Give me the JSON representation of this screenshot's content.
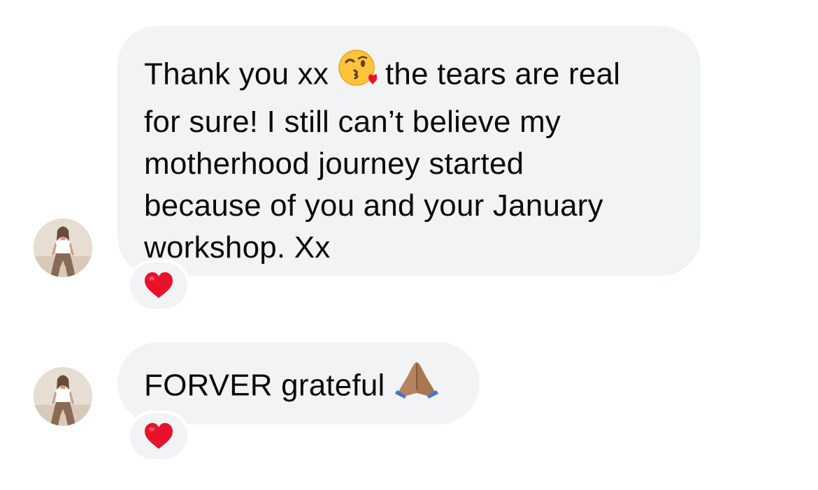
{
  "messages": [
    {
      "lines": [
        {
          "before": "Thank you xx",
          "after": "the tears are real"
        },
        {
          "text": "for sure! I still can’t believe my"
        },
        {
          "text": "motherhood journey started"
        },
        {
          "text": "because of you and your January"
        },
        {
          "text": "workshop. Xx"
        }
      ],
      "inline_emoji": "kissing-face-with-heart-emoji",
      "reaction_icon": "red-heart-icon"
    },
    {
      "text": "FORVER grateful",
      "inline_emoji": "folded-hands-emoji",
      "reaction_icon": "red-heart-icon"
    }
  ],
  "colors": {
    "bubble_bg": "#f2f3f5",
    "text": "#0b0b0b",
    "heart": "#e8122c"
  }
}
